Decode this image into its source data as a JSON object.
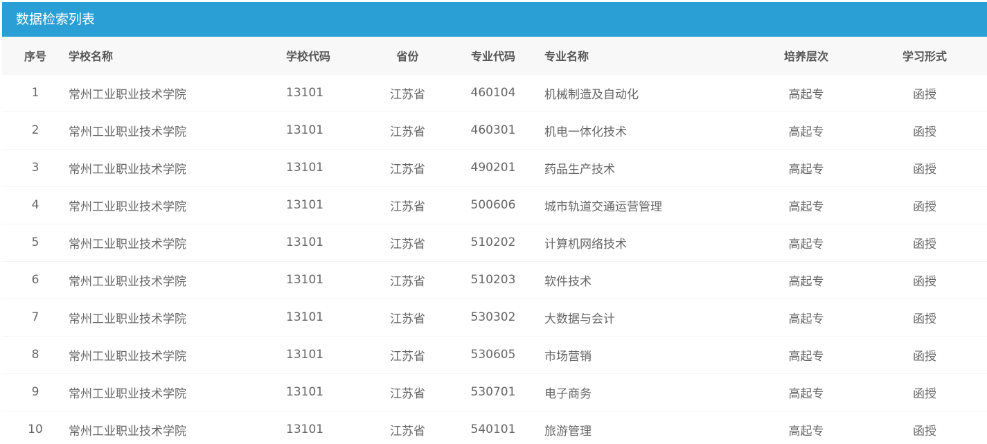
{
  "panel": {
    "title": "数据检索列表"
  },
  "table": {
    "headers": {
      "index": "序号",
      "school_name": "学校名称",
      "school_code": "学校代码",
      "province": "省份",
      "major_code": "专业代码",
      "major_name": "专业名称",
      "level": "培养层次",
      "study_form": "学习形式"
    },
    "rows": [
      {
        "index": "1",
        "school_name": "常州工业职业技术学院",
        "school_code": "13101",
        "province": "江苏省",
        "major_code": "460104",
        "major_name": "机械制造及自动化",
        "level": "高起专",
        "study_form": "函授"
      },
      {
        "index": "2",
        "school_name": "常州工业职业技术学院",
        "school_code": "13101",
        "province": "江苏省",
        "major_code": "460301",
        "major_name": "机电一体化技术",
        "level": "高起专",
        "study_form": "函授"
      },
      {
        "index": "3",
        "school_name": "常州工业职业技术学院",
        "school_code": "13101",
        "province": "江苏省",
        "major_code": "490201",
        "major_name": "药品生产技术",
        "level": "高起专",
        "study_form": "函授"
      },
      {
        "index": "4",
        "school_name": "常州工业职业技术学院",
        "school_code": "13101",
        "province": "江苏省",
        "major_code": "500606",
        "major_name": "城市轨道交通运营管理",
        "level": "高起专",
        "study_form": "函授"
      },
      {
        "index": "5",
        "school_name": "常州工业职业技术学院",
        "school_code": "13101",
        "province": "江苏省",
        "major_code": "510202",
        "major_name": "计算机网络技术",
        "level": "高起专",
        "study_form": "函授"
      },
      {
        "index": "6",
        "school_name": "常州工业职业技术学院",
        "school_code": "13101",
        "province": "江苏省",
        "major_code": "510203",
        "major_name": "软件技术",
        "level": "高起专",
        "study_form": "函授"
      },
      {
        "index": "7",
        "school_name": "常州工业职业技术学院",
        "school_code": "13101",
        "province": "江苏省",
        "major_code": "530302",
        "major_name": "大数据与会计",
        "level": "高起专",
        "study_form": "函授"
      },
      {
        "index": "8",
        "school_name": "常州工业职业技术学院",
        "school_code": "13101",
        "province": "江苏省",
        "major_code": "530605",
        "major_name": "市场营销",
        "level": "高起专",
        "study_form": "函授"
      },
      {
        "index": "9",
        "school_name": "常州工业职业技术学院",
        "school_code": "13101",
        "province": "江苏省",
        "major_code": "530701",
        "major_name": "电子商务",
        "level": "高起专",
        "study_form": "函授"
      },
      {
        "index": "10",
        "school_name": "常州工业职业技术学院",
        "school_code": "13101",
        "province": "江苏省",
        "major_code": "540101",
        "major_name": "旅游管理",
        "level": "高起专",
        "study_form": "函授"
      }
    ]
  },
  "colors": {
    "title_bar": "#2a9fd6",
    "header_bg": "#f8f8f8",
    "text": "#666666"
  }
}
